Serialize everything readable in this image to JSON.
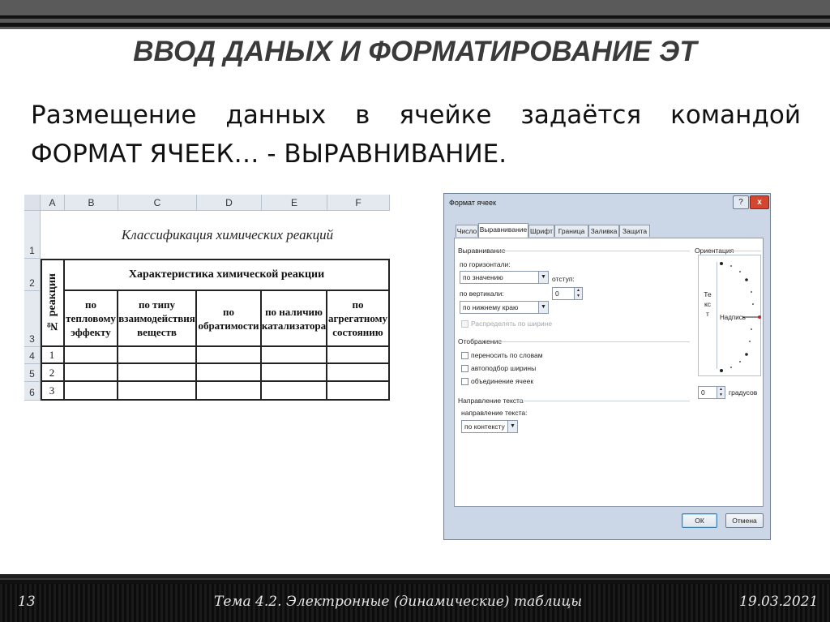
{
  "slide": {
    "title": "ВВОД ДАНЫХ И ФОРМАТИРОВАНИЕ ЭТ",
    "body_text": "Размещение данных в ячейке задаётся командой ФОРМАТ ЯЧЕЕК… - ВЫРАВНИВАНИЕ."
  },
  "sheet": {
    "columns": [
      "A",
      "B",
      "C",
      "D",
      "E",
      "F"
    ],
    "rows": [
      "1",
      "2",
      "3",
      "4",
      "5",
      "6"
    ],
    "caption": "Классификация химических реакций",
    "reaction_header": "№ реакции",
    "group_header": "Характеристика химической реакции",
    "subheaders": [
      "по тепловому эффекту",
      "по типу взаимодействия веществ",
      "по обратимости",
      "по наличию катализатора",
      "по агрегатному состоянию"
    ],
    "row_numbers": [
      "1",
      "2",
      "3"
    ]
  },
  "dialog": {
    "title": "Формат ячеек",
    "help": "?",
    "close": "x",
    "tabs": [
      "Число",
      "Выравнивание",
      "Шрифт",
      "Граница",
      "Заливка",
      "Защита"
    ],
    "active_tab": "Выравнивание",
    "alignment_group": "Выравнивание",
    "horizontal_label": "по горизонтали:",
    "horizontal_value": "по значению",
    "indent_label": "отступ:",
    "indent_value": "0",
    "vertical_label": "по вертикали:",
    "vertical_value": "по нижнему краю",
    "distributed_label": "Распределять по ширине",
    "display_group": "Отображение",
    "wrap_label": "переносить по словам",
    "autofit_label": "автоподбор ширины",
    "merge_label": "объединение ячеек",
    "direction_group": "Направление текста",
    "direction_label": "направление текста:",
    "direction_value": "по контексту",
    "orientation_group": "Ориентация",
    "orientation_vertical_text": "Текст",
    "orientation_label": "Надпись",
    "degrees_value": "0",
    "degrees_label": "градусов",
    "ok_label": "ОК",
    "cancel_label": "Отмена"
  },
  "footer": {
    "page_number": "13",
    "topic": "Тема 4.2. Электронные (динамические) таблицы",
    "date": "19.03.2021"
  }
}
